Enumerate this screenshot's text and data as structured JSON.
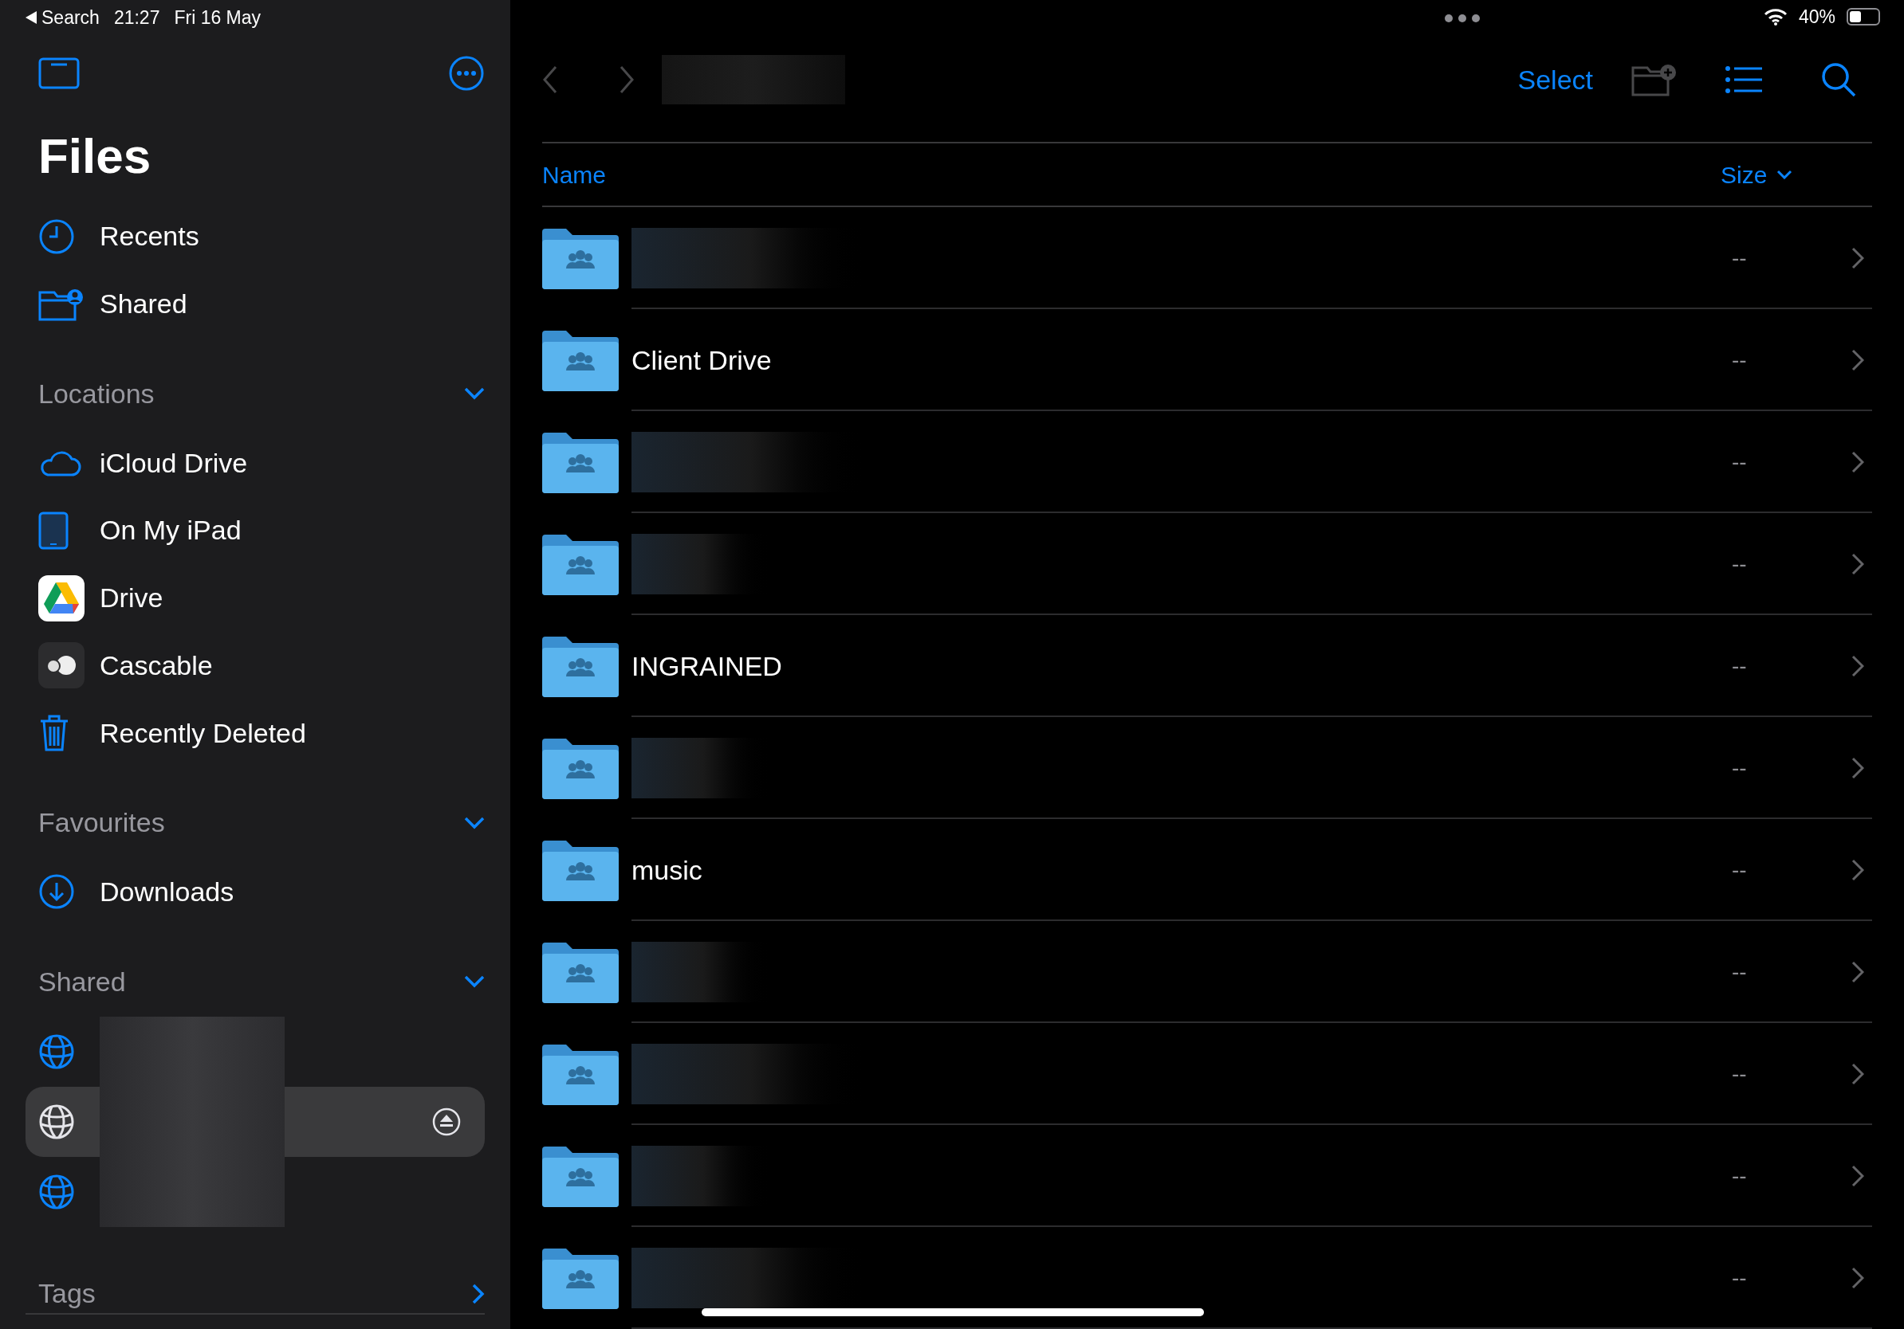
{
  "status_bar": {
    "back_label": "Search",
    "time": "21:27",
    "date": "Fri 16 May",
    "battery_text": "40%",
    "battery": {
      "level": 0.4
    }
  },
  "sidebar": {
    "title": "Files",
    "top_items": [
      {
        "label": "Recents",
        "kind": "clock"
      },
      {
        "label": "Shared",
        "kind": "shared-folder"
      }
    ],
    "sections": [
      {
        "title": "Locations",
        "expanded": true,
        "kind": "list",
        "items": [
          {
            "label": "iCloud Drive",
            "kind": "cloud"
          },
          {
            "label": "On My iPad",
            "kind": "tablet"
          },
          {
            "label": "Drive",
            "kind": "drive"
          },
          {
            "label": "Cascable",
            "kind": "cascable"
          },
          {
            "label": "Recently Deleted",
            "kind": "trash"
          }
        ]
      },
      {
        "title": "Favourites",
        "expanded": true,
        "kind": "list",
        "items": [
          {
            "label": "Downloads",
            "kind": "download"
          }
        ]
      },
      {
        "title": "Shared",
        "expanded": true,
        "kind": "servers",
        "items": [
          {
            "selected": false
          },
          {
            "selected": true
          },
          {
            "selected": false
          }
        ]
      },
      {
        "title": "Tags",
        "expanded": false,
        "kind": "link"
      }
    ]
  },
  "toolbar": {
    "select_label": "Select"
  },
  "table": {
    "columns": [
      {
        "label": "Name",
        "sorted": false
      },
      {
        "label": "Size",
        "sorted": true
      }
    ],
    "rows": [
      {
        "kind": "redacted",
        "size": "--"
      },
      {
        "kind": "named",
        "name": "Client Drive",
        "size": "--"
      },
      {
        "kind": "redacted",
        "size": "--"
      },
      {
        "kind": "redacted",
        "size": "--"
      },
      {
        "kind": "named",
        "name": "INGRAINED",
        "size": "--"
      },
      {
        "kind": "redacted",
        "size": "--"
      },
      {
        "kind": "named",
        "name": "music",
        "size": "--"
      },
      {
        "kind": "redacted",
        "size": "--"
      },
      {
        "kind": "redacted",
        "size": "--"
      },
      {
        "kind": "redacted",
        "size": "--"
      },
      {
        "kind": "redacted",
        "size": "--"
      }
    ]
  }
}
